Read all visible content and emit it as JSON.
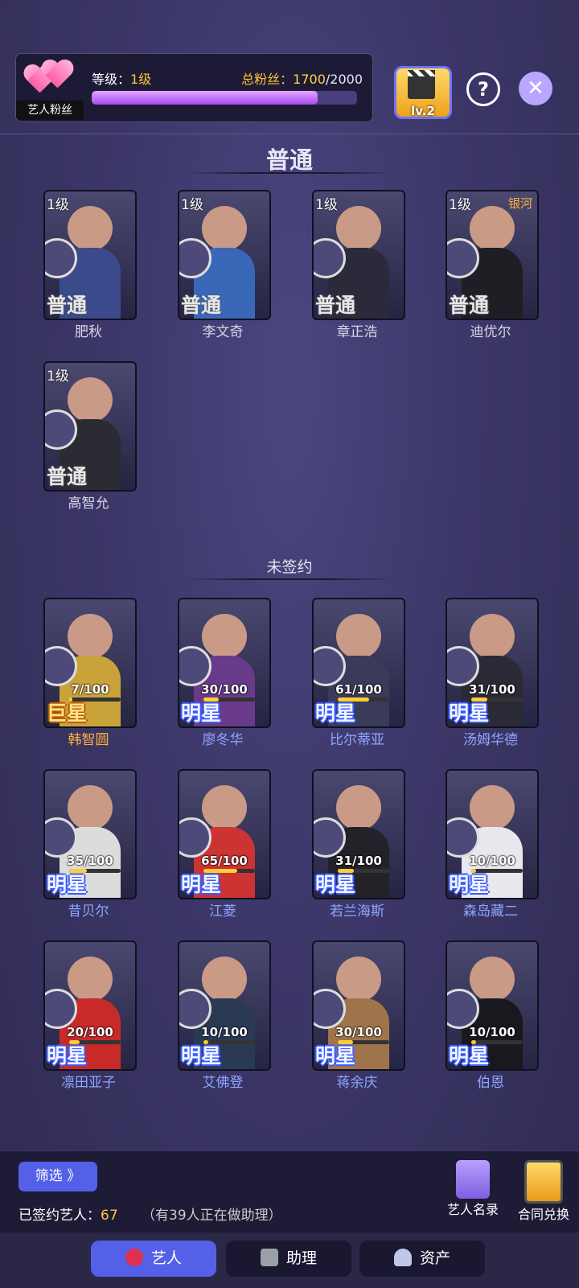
{
  "header": {
    "badge_label": "艺人粉丝",
    "level_prefix": "等级：",
    "level_value": "1级",
    "fans_prefix": "总粉丝：",
    "fans_current": "1700",
    "fans_sep": "/",
    "fans_max": "2000",
    "fans_fraction": 0.85,
    "lv_badge": "lv.2",
    "help_icon": "?",
    "close_icon": "✕"
  },
  "section_normal": {
    "title": "普通",
    "cards": [
      {
        "level": "1级",
        "tag": "",
        "rank": "普通",
        "name": "肥秋",
        "color": "#3a4a8a"
      },
      {
        "level": "1级",
        "tag": "",
        "rank": "普通",
        "name": "李文奇",
        "color": "#3a68b8"
      },
      {
        "level": "1级",
        "tag": "",
        "rank": "普通",
        "name": "章正浩",
        "color": "#2a2a3a"
      },
      {
        "level": "1级",
        "tag": "银河",
        "rank": "普通",
        "name": "迪优尔",
        "color": "#1e1e24"
      },
      {
        "level": "1级",
        "tag": "",
        "rank": "普通",
        "name": "高智允",
        "color": "#2b2b33"
      }
    ]
  },
  "section_unsigned": {
    "title": "未签约",
    "cards": [
      {
        "progress": "7/100",
        "fraction": 0.07,
        "rank": "巨星",
        "name": "韩智圆",
        "tier": "gold",
        "color": "#c9a33a"
      },
      {
        "progress": "30/100",
        "fraction": 0.3,
        "rank": "明星",
        "name": "廖冬华",
        "tier": "blue",
        "color": "#6a3a8a"
      },
      {
        "progress": "61/100",
        "fraction": 0.61,
        "rank": "明星",
        "name": "比尔蒂亚",
        "tier": "blue",
        "color": "#3a3a5a"
      },
      {
        "progress": "31/100",
        "fraction": 0.31,
        "rank": "明星",
        "name": "汤姆华德",
        "tier": "blue",
        "color": "#2a2a36"
      },
      {
        "progress": "35/100",
        "fraction": 0.35,
        "rank": "明星",
        "name": "昔贝尔",
        "tier": "blue",
        "color": "#dcdcdc"
      },
      {
        "progress": "65/100",
        "fraction": 0.65,
        "rank": "明星",
        "name": "江菱",
        "tier": "blue",
        "color": "#cc3333"
      },
      {
        "progress": "31/100",
        "fraction": 0.31,
        "rank": "明星",
        "name": "若兰海斯",
        "tier": "blue",
        "color": "#222228"
      },
      {
        "progress": "10/100",
        "fraction": 0.1,
        "rank": "明星",
        "name": "森岛藏二",
        "tier": "blue",
        "color": "#e8e8ee"
      },
      {
        "progress": "20/100",
        "fraction": 0.2,
        "rank": "明星",
        "name": "凛田亚子",
        "tier": "blue",
        "color": "#c82a2a"
      },
      {
        "progress": "10/100",
        "fraction": 0.1,
        "rank": "明星",
        "name": "艾佛登",
        "tier": "blue",
        "color": "#2a3a55"
      },
      {
        "progress": "30/100",
        "fraction": 0.3,
        "rank": "明星",
        "name": "蒋余庆",
        "tier": "blue",
        "color": "#a0744a"
      },
      {
        "progress": "10/100",
        "fraction": 0.1,
        "rank": "明星",
        "name": "伯恩",
        "tier": "blue",
        "color": "#18181e"
      }
    ]
  },
  "footer": {
    "filter_label": "筛选 》",
    "signed_label": "已签约艺人：",
    "signed_count": "67",
    "assist_text": "（有39人正在做助理）",
    "roster_label": "艺人名录",
    "exchange_label": "合同兑换"
  },
  "tabs": [
    {
      "label": "艺人",
      "icon": "artist-icon"
    },
    {
      "label": "助理",
      "icon": "assistant-icon"
    },
    {
      "label": "资产",
      "icon": "assets-icon"
    }
  ],
  "colors": {
    "accent": "#5560e8",
    "gold": "#ffc43a",
    "name_gold": "#ffb13a",
    "name_blue": "#8ea6ff",
    "name_gray": "#d8d6e6"
  }
}
